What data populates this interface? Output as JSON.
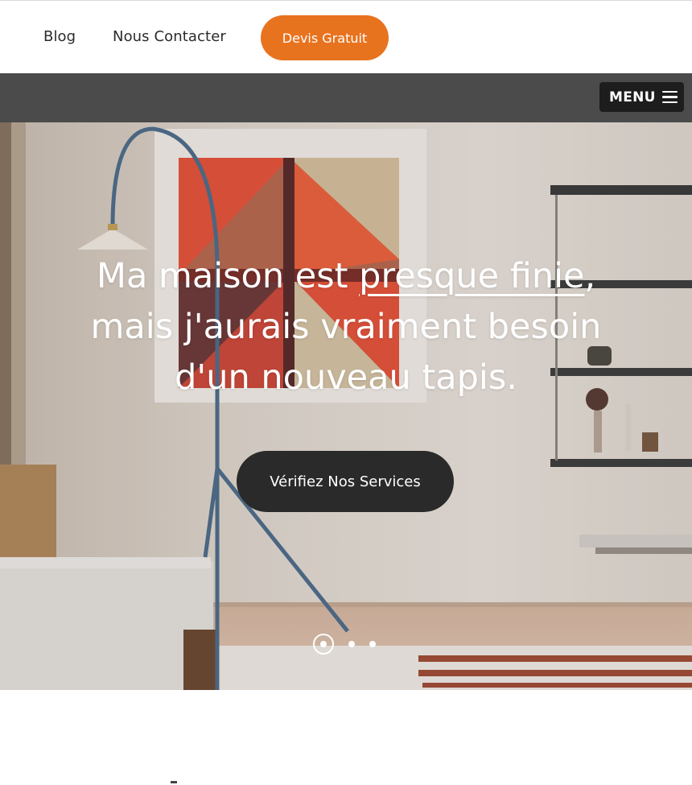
{
  "nav": {
    "links": [
      {
        "label": "Blog"
      },
      {
        "label": "Nous Contacter"
      }
    ],
    "cta_label": "Devis Gratuit"
  },
  "menubar": {
    "menu_label": "MENU",
    "icon": "hamburger-icon"
  },
  "hero": {
    "title_part1": "Ma maison est ",
    "title_underlined": "presque finie",
    "title_part2": ",",
    "title_line2": "mais j'aurais vraiment besoin",
    "title_line3": "d'un nouveau tapis.",
    "cta_label": "Vérifiez Nos Services",
    "slides_total": 3,
    "slide_active": 1
  },
  "colors": {
    "accent_orange": "#e8731f",
    "menubar_bg": "#4b4b4b",
    "dark_button": "#2a2a2a"
  }
}
